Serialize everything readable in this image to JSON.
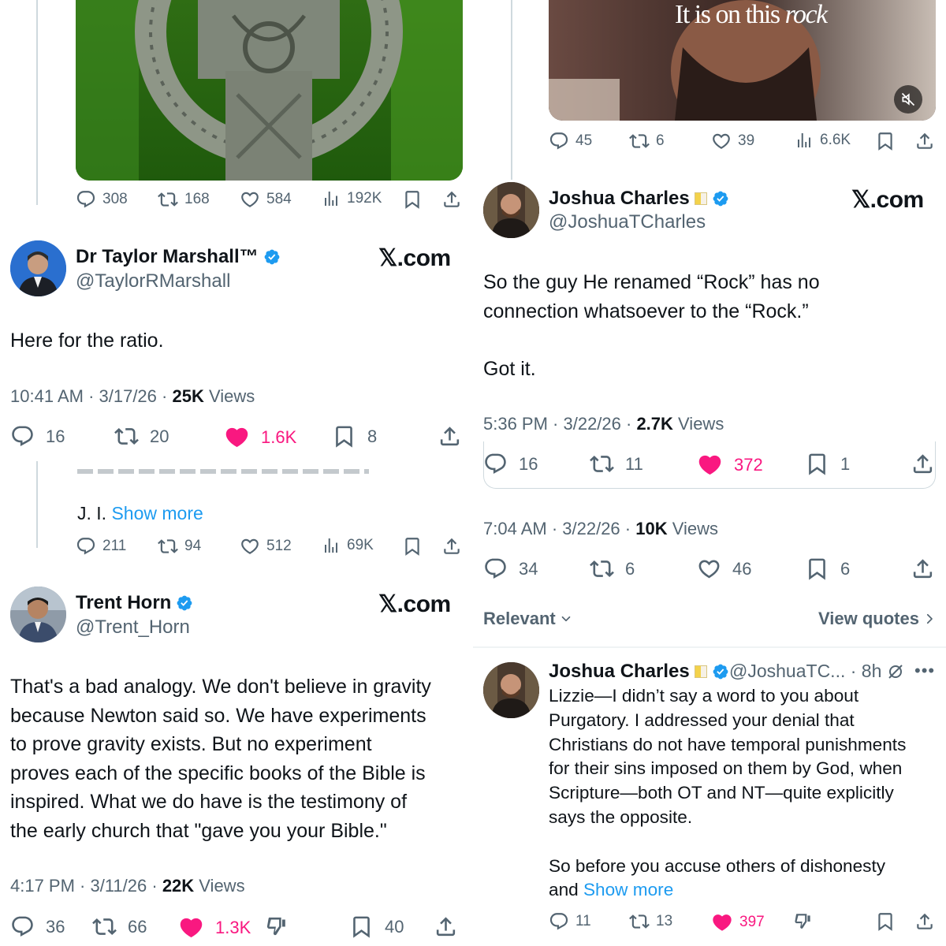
{
  "left": {
    "top_tweet": {
      "replies": "308",
      "reposts": "168",
      "likes": "584",
      "views": "192K"
    },
    "marshall": {
      "name": "Dr Taylor Marshall™",
      "handle": "@TaylorRMarshall",
      "brand": "𝕏.com",
      "text": "Here for the ratio.",
      "time": "10:41 AM · 3/17/26 · ",
      "views_count": "25K",
      "views_label": " Views",
      "replies": "16",
      "reposts": "20",
      "likes": "1.6K",
      "bookmarks": "8"
    },
    "snippet": {
      "text": "J. I. ",
      "show_more": "Show more",
      "replies": "211",
      "reposts": "94",
      "likes": "512",
      "views": "69K"
    },
    "horn": {
      "name": "Trent Horn",
      "handle": "@Trent_Horn",
      "brand": "𝕏.com",
      "text": "That's a bad analogy. We don't believe in gravity\nbecause Newton said so. We have experiments\nto prove gravity exists. But no experiment\nproves each of the specific books of the Bible is\ninspired. What we do have is the testimony of\nthe early church that \"gave you your Bible.\"",
      "time": "4:17 PM · 3/11/26 · ",
      "views_count": "22K",
      "views_label": " Views",
      "replies": "36",
      "reposts": "66",
      "likes": "1.3K",
      "bookmarks": "40"
    }
  },
  "right": {
    "video": {
      "caption_plain": "It is on this ",
      "caption_italic": "rock",
      "replies": "45",
      "reposts": "6",
      "likes": "39",
      "views": "6.6K"
    },
    "charles": {
      "name": "Joshua Charles",
      "handle": "@JoshuaTCharles",
      "brand": "𝕏.com",
      "text": "So the guy He renamed “Rock” has no\nconnection whatsoever to the “Rock.”\n\nGot it.",
      "time": "5:36 PM · 3/22/26 · ",
      "views_count": "2.7K",
      "views_label": " Views",
      "replies": "16",
      "reposts": "11",
      "likes": "372",
      "bookmarks": "1"
    },
    "quote_meta": {
      "time": "7:04 AM · 3/22/26 · ",
      "views_count": "10K",
      "views_label": " Views",
      "replies": "34",
      "reposts": "6",
      "likes": "46",
      "bookmarks": "6"
    },
    "sort": {
      "relevant": "Relevant",
      "view_quotes": "View quotes"
    },
    "reply": {
      "name": "Joshua Charles",
      "handle_time": "@JoshuaTC... · 8h",
      "text": "Lizzie—I didn’t say a word to you about\nPurgatory. I addressed your denial that\nChristians do not have temporal punishments\nfor their sins imposed on them by God, when\nScripture—both OT and NT—quite explicitly\nsays the opposite.\n\nSo before you accuse others of dishonesty\nand ",
      "show_more": "Show more",
      "replies": "11",
      "reposts": "13",
      "likes": "397"
    }
  },
  "colors": {
    "like_pink": "#f91880",
    "verified_blue": "#1d9bf0",
    "gray": "#536471",
    "divider": "#eff3f4"
  }
}
